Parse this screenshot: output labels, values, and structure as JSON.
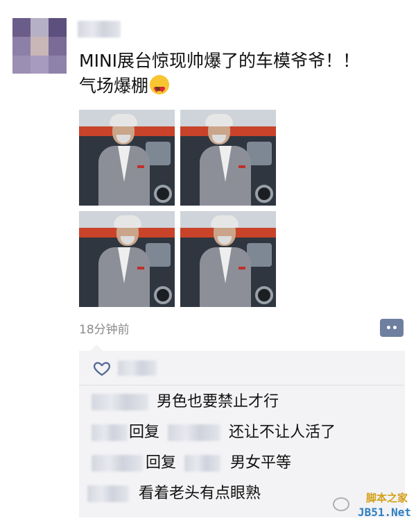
{
  "post": {
    "text_line1": "MINI展台惊现帅爆了的车模爷爷！！",
    "text_line2": "气场爆棚",
    "emoji": "heart-eyes-emoji",
    "photo_count": 4,
    "timestamp": "18分钟前"
  },
  "comments": [
    {
      "text": "男色也要禁止才行"
    },
    {
      "reply_label": "回复",
      "text": "还让不让人活了"
    },
    {
      "reply_label": "回复",
      "text": "男女平等"
    },
    {
      "text": "看着老头有点眼熟"
    }
  ],
  "watermark": {
    "site_cn": "脚本之家",
    "domain": "JB51.Net"
  },
  "colors": {
    "comment_bg": "#f3f3f5",
    "link_blue": "#576b95",
    "timestamp_gray": "#8a8a8a"
  }
}
